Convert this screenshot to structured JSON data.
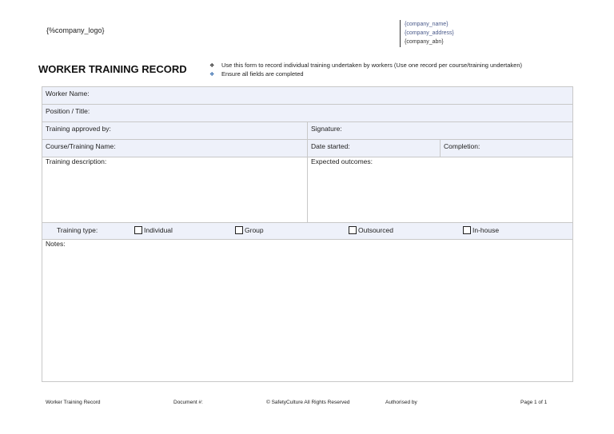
{
  "header": {
    "logo": "{%company_logo}",
    "company_name": "{company_name}",
    "company_address": "{company_address}",
    "company_abn": "{company_abn}"
  },
  "title": "WORKER TRAINING RECORD",
  "instructions": [
    "Use this form to record individual training undertaken by workers (Use one record per course/training undertaken)",
    "Ensure all fields are completed"
  ],
  "bullet_glyph": "❖",
  "form": {
    "worker_name": "Worker Name:",
    "position": "Position / Title:",
    "approved_by": "Training approved by:",
    "signature": "Signature:",
    "course_name": "Course/Training Name:",
    "date_started": "Date started:",
    "completion": "Completion:",
    "description": "Training description:",
    "outcomes": "Expected outcomes:",
    "training_type": "Training type:",
    "options": [
      "Individual",
      "Group",
      "Outsourced",
      "In-house"
    ],
    "notes": "Notes:"
  },
  "footer": {
    "doc_title": "Worker Training Record",
    "document_no": "Document #:",
    "copyright": "© SafetyCulture All Rights Reserved",
    "authorised": "Authorised by",
    "page": "Page 1 of 1"
  }
}
